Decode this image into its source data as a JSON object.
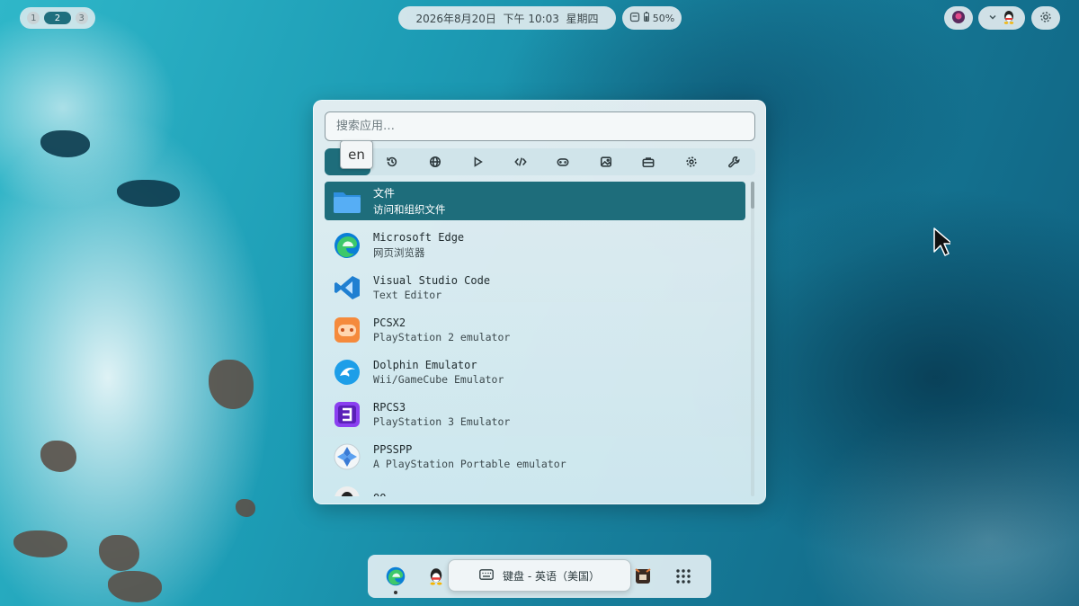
{
  "topbar": {
    "workspaces": [
      "1",
      "2",
      "3"
    ],
    "active_workspace": "2",
    "datetime": "2026年8月20日  下午 10:03  星期四",
    "battery": "50%"
  },
  "launcher": {
    "search_placeholder": "搜索应用…",
    "tooltip": "en",
    "categories": [
      {
        "name": "all",
        "icon": "grid-icon"
      },
      {
        "name": "recent",
        "icon": "history-icon"
      },
      {
        "name": "internet",
        "icon": "globe-icon"
      },
      {
        "name": "media",
        "icon": "play-icon"
      },
      {
        "name": "development",
        "icon": "code-icon"
      },
      {
        "name": "games",
        "icon": "gamepad-icon"
      },
      {
        "name": "graphics",
        "icon": "image-icon"
      },
      {
        "name": "office",
        "icon": "briefcase-icon"
      },
      {
        "name": "settings",
        "icon": "gear-icon"
      },
      {
        "name": "utilities",
        "icon": "wrench-icon"
      }
    ],
    "apps": [
      {
        "name": "文件",
        "desc": "访问和组织文件",
        "icon": "folder-icon"
      },
      {
        "name": "Microsoft Edge",
        "desc": "网页浏览器",
        "icon": "edge-icon"
      },
      {
        "name": "Visual Studio Code",
        "desc": "Text Editor",
        "icon": "vscode-icon"
      },
      {
        "name": "PCSX2",
        "desc": "PlayStation 2 emulator",
        "icon": "pcsx2-icon"
      },
      {
        "name": "Dolphin Emulator",
        "desc": "Wii/GameCube Emulator",
        "icon": "dolphin-icon"
      },
      {
        "name": "RPCS3",
        "desc": "PlayStation 3 Emulator",
        "icon": "rpcs3-icon"
      },
      {
        "name": "PPSSPP",
        "desc": "A PlayStation Portable emulator",
        "icon": "ppsspp-icon"
      },
      {
        "name": "QQ",
        "desc": "",
        "icon": "qq-icon"
      }
    ]
  },
  "dock": {
    "osd_label": "键盘 - 英语（美国）"
  },
  "colors": {
    "accent": "#1e6d7b"
  }
}
